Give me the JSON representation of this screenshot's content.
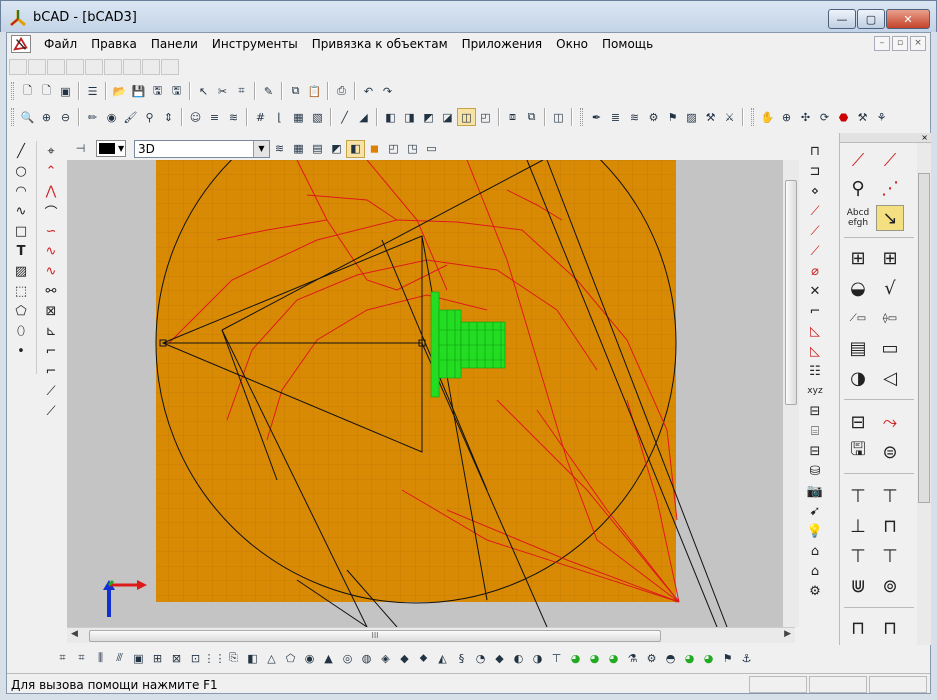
{
  "window": {
    "title": "bCAD - [bCAD3]",
    "minimize": "—",
    "maximize": "▢",
    "close": "✕"
  },
  "menu": {
    "items": [
      "Файл",
      "Правка",
      "Панели",
      "Инструменты",
      "Привязка к объектам",
      "Приложения",
      "Окно",
      "Помощь"
    ],
    "mdi": [
      "–",
      "▫",
      "×"
    ]
  },
  "view_toolbar": {
    "color_value": "black",
    "view_select": "3D"
  },
  "scrollbar": {
    "grip": "III",
    "left_arrow": "◀",
    "right_arrow": "▶"
  },
  "right_panel": {
    "text_tool": "Abcd\nefgh"
  },
  "status": {
    "message": "Для вызова помощи нажмите F1"
  },
  "colors": {
    "canvas_bg": "#d98a05",
    "grid": "#c07b0a",
    "red_lines": "#dd1a1a",
    "black_lines": "#111111",
    "green_object": "#22dd22"
  }
}
